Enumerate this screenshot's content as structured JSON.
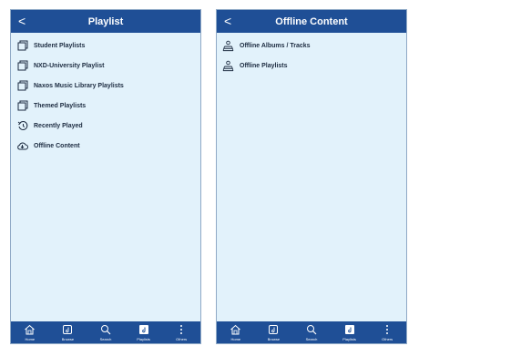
{
  "left": {
    "header": {
      "back": "<",
      "title": "Playlist"
    },
    "items": [
      {
        "label": "Student Playlists",
        "icon": "playlist-icon"
      },
      {
        "label": "NXD-University Playlist",
        "icon": "playlist-icon"
      },
      {
        "label": "Naxos Music Library Playlists",
        "icon": "playlist-icon"
      },
      {
        "label": "Themed Playlists",
        "icon": "playlist-icon"
      },
      {
        "label": "Recently Played",
        "icon": "history-icon"
      },
      {
        "label": "Offline Content",
        "icon": "download-icon"
      }
    ],
    "tabs": [
      {
        "label": "Home",
        "icon": "home-icon"
      },
      {
        "label": "Browse",
        "icon": "browse-icon"
      },
      {
        "label": "Search",
        "icon": "search-icon"
      },
      {
        "label": "Playlists",
        "icon": "playlists-icon",
        "active": true
      },
      {
        "label": "Others",
        "icon": "more-icon"
      }
    ]
  },
  "right": {
    "header": {
      "back": "<",
      "title": "Offline Content"
    },
    "items": [
      {
        "label": "Offline Albums / Tracks",
        "icon": "offline-stack-icon"
      },
      {
        "label": "Offline Playlists",
        "icon": "offline-stack-icon"
      }
    ],
    "tabs": [
      {
        "label": "Home",
        "icon": "home-icon"
      },
      {
        "label": "Browse",
        "icon": "browse-icon"
      },
      {
        "label": "Search",
        "icon": "search-icon"
      },
      {
        "label": "Playlists",
        "icon": "playlists-icon",
        "active": true
      },
      {
        "label": "Others",
        "icon": "more-icon"
      }
    ]
  },
  "colors": {
    "header": "#1f4f96",
    "screen": "#e2f2fb",
    "text": "#1c2b40"
  }
}
